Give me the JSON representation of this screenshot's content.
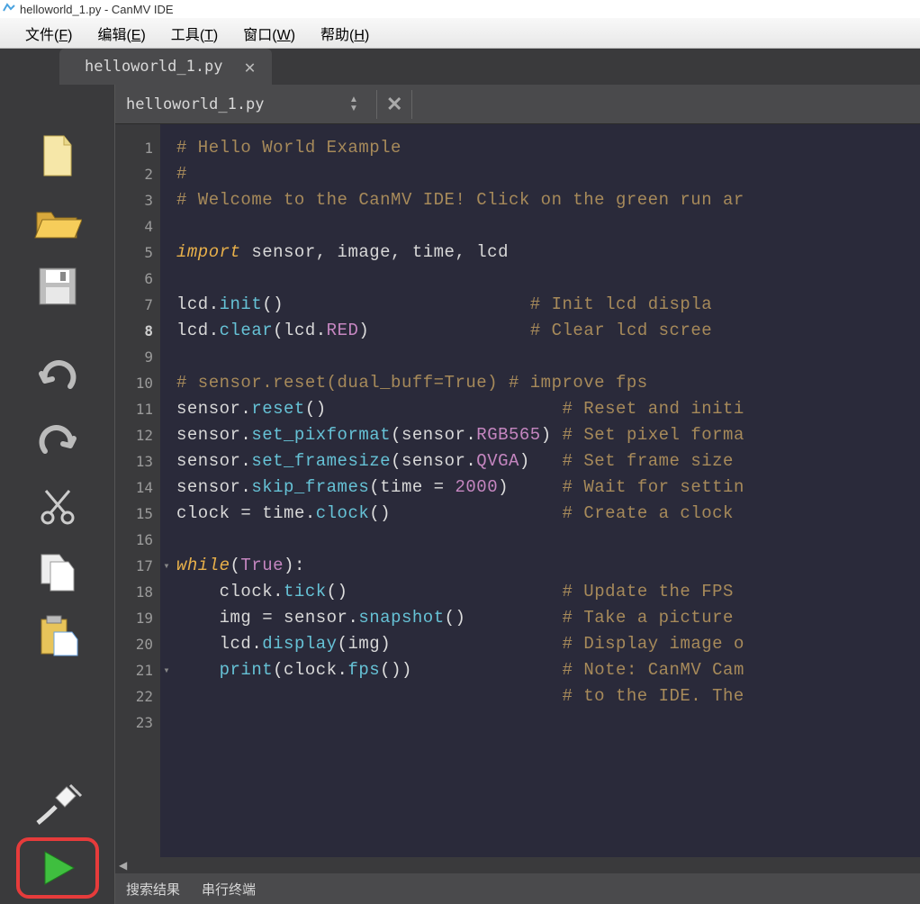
{
  "window": {
    "title": "helloworld_1.py - CanMV IDE"
  },
  "menu": {
    "items": [
      {
        "label": "文件",
        "accel": "F"
      },
      {
        "label": "编辑",
        "accel": "E"
      },
      {
        "label": "工具",
        "accel": "T"
      },
      {
        "label": "窗口",
        "accel": "W"
      },
      {
        "label": "帮助",
        "accel": "H"
      }
    ]
  },
  "tab": {
    "label": "helloworld_1.py"
  },
  "file_dropdown": {
    "label": "helloworld_1.py"
  },
  "gutter": {
    "lines": [
      1,
      2,
      3,
      4,
      5,
      6,
      7,
      8,
      9,
      10,
      11,
      12,
      13,
      14,
      15,
      16,
      17,
      18,
      19,
      20,
      21,
      22,
      23
    ],
    "current": 8,
    "fold_markers": {
      "17": "▾",
      "21": "▾"
    }
  },
  "code": {
    "lines": [
      [
        {
          "c": "tk-comment",
          "t": "# Hello World Example"
        }
      ],
      [
        {
          "c": "tk-comment",
          "t": "#"
        }
      ],
      [
        {
          "c": "tk-comment",
          "t": "# Welcome to the CanMV IDE! Click on the green run ar"
        }
      ],
      [],
      [
        {
          "c": "tk-keyword",
          "t": "import"
        },
        {
          "c": "",
          "t": " "
        },
        {
          "c": "tk-ident",
          "t": "sensor, image, time, lcd"
        }
      ],
      [],
      [
        {
          "c": "tk-ident",
          "t": "lcd"
        },
        {
          "c": "",
          "t": "."
        },
        {
          "c": "tk-func",
          "t": "init"
        },
        {
          "c": "tk-paren",
          "t": "()"
        },
        {
          "c": "",
          "t": "                       "
        },
        {
          "c": "tk-comment",
          "t": "# Init lcd displa"
        }
      ],
      [
        {
          "c": "tk-ident",
          "t": "lcd"
        },
        {
          "c": "",
          "t": "."
        },
        {
          "c": "tk-func",
          "t": "clear"
        },
        {
          "c": "tk-paren",
          "t": "("
        },
        {
          "c": "tk-ident",
          "t": "lcd"
        },
        {
          "c": "",
          "t": "."
        },
        {
          "c": "tk-attr",
          "t": "RED"
        },
        {
          "c": "tk-paren",
          "t": ")"
        },
        {
          "c": "",
          "t": "               "
        },
        {
          "c": "tk-comment",
          "t": "# Clear lcd scree"
        }
      ],
      [],
      [
        {
          "c": "tk-comment",
          "t": "# sensor.reset(dual_buff=True) # improve fps"
        }
      ],
      [
        {
          "c": "tk-ident",
          "t": "sensor"
        },
        {
          "c": "",
          "t": "."
        },
        {
          "c": "tk-func",
          "t": "reset"
        },
        {
          "c": "tk-paren",
          "t": "()"
        },
        {
          "c": "",
          "t": "                      "
        },
        {
          "c": "tk-comment",
          "t": "# Reset and initi"
        }
      ],
      [
        {
          "c": "tk-ident",
          "t": "sensor"
        },
        {
          "c": "",
          "t": "."
        },
        {
          "c": "tk-func",
          "t": "set_pixformat"
        },
        {
          "c": "tk-paren",
          "t": "("
        },
        {
          "c": "tk-ident",
          "t": "sensor"
        },
        {
          "c": "",
          "t": "."
        },
        {
          "c": "tk-attr",
          "t": "RGB565"
        },
        {
          "c": "tk-paren",
          "t": ")"
        },
        {
          "c": "",
          "t": " "
        },
        {
          "c": "tk-comment",
          "t": "# Set pixel forma"
        }
      ],
      [
        {
          "c": "tk-ident",
          "t": "sensor"
        },
        {
          "c": "",
          "t": "."
        },
        {
          "c": "tk-func",
          "t": "set_framesize"
        },
        {
          "c": "tk-paren",
          "t": "("
        },
        {
          "c": "tk-ident",
          "t": "sensor"
        },
        {
          "c": "",
          "t": "."
        },
        {
          "c": "tk-attr",
          "t": "QVGA"
        },
        {
          "c": "tk-paren",
          "t": ")"
        },
        {
          "c": "",
          "t": "   "
        },
        {
          "c": "tk-comment",
          "t": "# Set frame size "
        }
      ],
      [
        {
          "c": "tk-ident",
          "t": "sensor"
        },
        {
          "c": "",
          "t": "."
        },
        {
          "c": "tk-func",
          "t": "skip_frames"
        },
        {
          "c": "tk-paren",
          "t": "("
        },
        {
          "c": "tk-ident",
          "t": "time"
        },
        {
          "c": "",
          "t": " = "
        },
        {
          "c": "tk-number",
          "t": "2000"
        },
        {
          "c": "tk-paren",
          "t": ")"
        },
        {
          "c": "",
          "t": "     "
        },
        {
          "c": "tk-comment",
          "t": "# Wait for settin"
        }
      ],
      [
        {
          "c": "tk-ident",
          "t": "clock"
        },
        {
          "c": "",
          "t": " = "
        },
        {
          "c": "tk-ident",
          "t": "time"
        },
        {
          "c": "",
          "t": "."
        },
        {
          "c": "tk-func",
          "t": "clock"
        },
        {
          "c": "tk-paren",
          "t": "()"
        },
        {
          "c": "",
          "t": "                "
        },
        {
          "c": "tk-comment",
          "t": "# Create a clock "
        }
      ],
      [],
      [
        {
          "c": "tk-keyword",
          "t": "while"
        },
        {
          "c": "tk-paren",
          "t": "("
        },
        {
          "c": "tk-const",
          "t": "True"
        },
        {
          "c": "tk-paren",
          "t": ")"
        },
        {
          "c": "",
          "t": ":"
        }
      ],
      [
        {
          "c": "",
          "t": "    "
        },
        {
          "c": "tk-ident",
          "t": "clock"
        },
        {
          "c": "",
          "t": "."
        },
        {
          "c": "tk-func",
          "t": "tick"
        },
        {
          "c": "tk-paren",
          "t": "()"
        },
        {
          "c": "",
          "t": "                    "
        },
        {
          "c": "tk-comment",
          "t": "# Update the FPS "
        }
      ],
      [
        {
          "c": "",
          "t": "    "
        },
        {
          "c": "tk-ident",
          "t": "img"
        },
        {
          "c": "",
          "t": " = "
        },
        {
          "c": "tk-ident",
          "t": "sensor"
        },
        {
          "c": "",
          "t": "."
        },
        {
          "c": "tk-func",
          "t": "snapshot"
        },
        {
          "c": "tk-paren",
          "t": "()"
        },
        {
          "c": "",
          "t": "         "
        },
        {
          "c": "tk-comment",
          "t": "# Take a picture "
        }
      ],
      [
        {
          "c": "",
          "t": "    "
        },
        {
          "c": "tk-ident",
          "t": "lcd"
        },
        {
          "c": "",
          "t": "."
        },
        {
          "c": "tk-func",
          "t": "display"
        },
        {
          "c": "tk-paren",
          "t": "("
        },
        {
          "c": "tk-ident",
          "t": "img"
        },
        {
          "c": "tk-paren",
          "t": ")"
        },
        {
          "c": "",
          "t": "                "
        },
        {
          "c": "tk-comment",
          "t": "# Display image o"
        }
      ],
      [
        {
          "c": "",
          "t": "    "
        },
        {
          "c": "tk-func",
          "t": "print"
        },
        {
          "c": "tk-paren",
          "t": "("
        },
        {
          "c": "tk-ident",
          "t": "clock"
        },
        {
          "c": "",
          "t": "."
        },
        {
          "c": "tk-func",
          "t": "fps"
        },
        {
          "c": "tk-paren",
          "t": "())"
        },
        {
          "c": "",
          "t": "              "
        },
        {
          "c": "tk-comment",
          "t": "# Note: CanMV Cam"
        }
      ],
      [
        {
          "c": "",
          "t": "                                    "
        },
        {
          "c": "tk-comment",
          "t": "# to the IDE. The"
        }
      ],
      []
    ]
  },
  "bottom_panel": {
    "tabs": [
      "搜索结果",
      "串行终端"
    ]
  },
  "icons": {
    "new": "new-file-icon",
    "open": "open-folder-icon",
    "save": "save-icon",
    "undo": "undo-icon",
    "redo": "redo-icon",
    "cut": "cut-icon",
    "copy": "copy-icon",
    "paste": "paste-icon",
    "connect": "connect-plug-icon",
    "run": "run-play-icon"
  }
}
